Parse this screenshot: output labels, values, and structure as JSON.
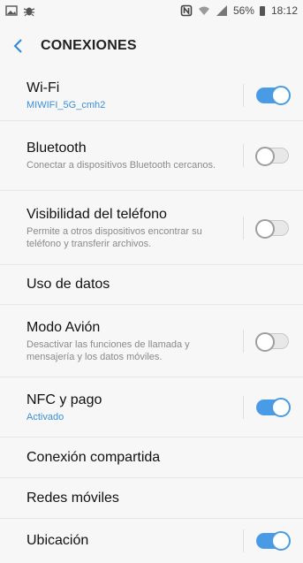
{
  "status_bar": {
    "left_icons": [
      "gallery-icon",
      "bug-icon"
    ],
    "right_icons": [
      "nfc-icon",
      "wifi-icon",
      "signal-icon"
    ],
    "battery": "56%",
    "time": "18:12"
  },
  "header": {
    "title": "CONEXIONES"
  },
  "items": [
    {
      "title": "Wi-Fi",
      "subtitle": "MIWIFI_5G_cmh2",
      "toggle": true
    },
    {
      "title": "Bluetooth",
      "subtitle": "Conectar a dispositivos Bluetooth cercanos.",
      "toggle": false
    },
    {
      "title": "Visibilidad del teléfono",
      "subtitle": "Permite a otros dispositivos encontrar su teléfono y transferir archivos.",
      "toggle": false
    },
    {
      "title": "Uso de datos"
    },
    {
      "title": "Modo Avión",
      "subtitle": "Desactivar las funciones de llamada y mensajería y los datos móviles.",
      "toggle": false
    },
    {
      "title": "NFC y pago",
      "subtitle": "Activado",
      "toggle": true
    },
    {
      "title": "Conexión compartida"
    },
    {
      "title": "Redes móviles"
    },
    {
      "title": "Ubicación",
      "toggle": true
    }
  ],
  "colors": {
    "accent": "#4a9be5",
    "background": "#f7f7f7"
  }
}
